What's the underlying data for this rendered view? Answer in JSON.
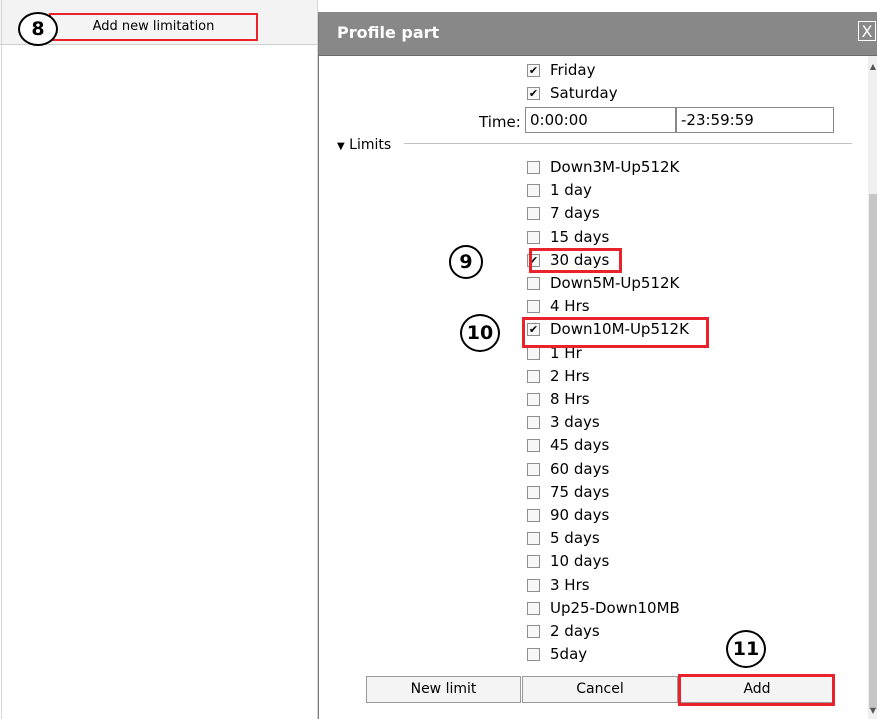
{
  "left": {
    "add_button_label": "Add new limitation"
  },
  "dialog": {
    "title": "Profile part",
    "close_glyph": "X",
    "days": [
      {
        "label": "Friday",
        "checked": true
      },
      {
        "label": "Saturday",
        "checked": true
      }
    ],
    "time_label": "Time:",
    "time_start": "0:00:00",
    "time_end": "-23:59:59",
    "limits_label": "Limits",
    "limits": [
      {
        "label": "Down3M-Up512K",
        "checked": false
      },
      {
        "label": "1 day",
        "checked": false
      },
      {
        "label": "7 days",
        "checked": false
      },
      {
        "label": "15 days",
        "checked": false
      },
      {
        "label": "30 days",
        "checked": true
      },
      {
        "label": "Down5M-Up512K",
        "checked": false
      },
      {
        "label": "4 Hrs",
        "checked": false
      },
      {
        "label": "Down10M-Up512K",
        "checked": true
      },
      {
        "label": "1 Hr",
        "checked": false
      },
      {
        "label": "2 Hrs",
        "checked": false
      },
      {
        "label": "8 Hrs",
        "checked": false
      },
      {
        "label": "3 days",
        "checked": false
      },
      {
        "label": "45 days",
        "checked": false
      },
      {
        "label": "60 days",
        "checked": false
      },
      {
        "label": "75 days",
        "checked": false
      },
      {
        "label": "90 days",
        "checked": false
      },
      {
        "label": "5 days",
        "checked": false
      },
      {
        "label": "10 days",
        "checked": false
      },
      {
        "label": "3 Hrs",
        "checked": false
      },
      {
        "label": "Up25-Down10MB",
        "checked": false
      },
      {
        "label": "2 days",
        "checked": false
      },
      {
        "label": "5day",
        "checked": false
      }
    ],
    "buttons": {
      "new_limit": "New limit",
      "cancel": "Cancel",
      "add": "Add"
    }
  },
  "callouts": {
    "c8": "8",
    "c9": "9",
    "c10": "10",
    "c11": "11"
  },
  "colors": {
    "highlight": "#e8232b",
    "titlebar": "#888888"
  },
  "icons": {
    "checkmark": "✔",
    "limits_toggle": "▼"
  }
}
